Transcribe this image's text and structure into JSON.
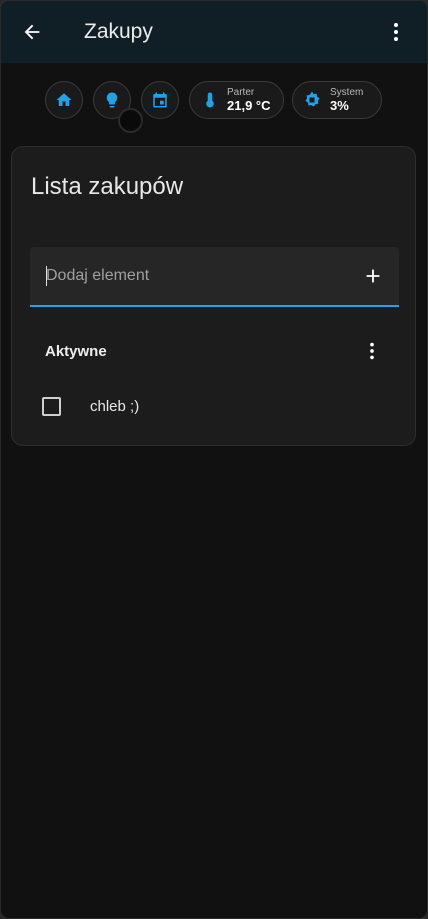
{
  "header": {
    "title": "Zakupy",
    "back_icon": "arrow-left-icon",
    "menu_icon": "more-vertical-icon"
  },
  "chips": [
    {
      "icon": "home-icon"
    },
    {
      "icon": "lightbulb-icon"
    },
    {
      "icon": "calendar-icon"
    },
    {
      "icon": "thermometer-icon",
      "label": "Parter",
      "value": "21,9 °C"
    },
    {
      "icon": "chip-icon",
      "label": "System",
      "value": "3%"
    }
  ],
  "card": {
    "title": "Lista zakupów",
    "input": {
      "placeholder": "Dodaj element",
      "value": ""
    },
    "section_title": "Aktywne",
    "items": [
      {
        "label": "chleb ;)",
        "checked": false
      }
    ]
  },
  "colors": {
    "accent": "#1fa3e6",
    "topbar": "#101e25",
    "background": "#111111",
    "card": "#1c1c1c"
  }
}
